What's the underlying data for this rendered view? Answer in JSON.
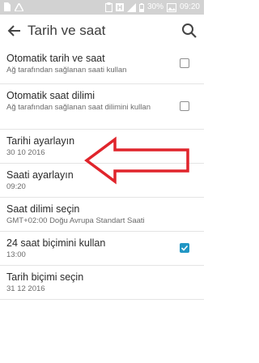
{
  "status_bar": {
    "battery_percent": "30%",
    "time": "09:20"
  },
  "app_bar": {
    "title": "Tarih ve saat"
  },
  "settings": [
    {
      "title": "Otomatik tarih ve saat",
      "subtitle": "Ağ tarafından sağlanan saati kullan",
      "checkbox": true,
      "checked": false
    },
    {
      "title": "Otomatik saat dilimi",
      "subtitle": "Ağ tarafından sağlanan saat dilimini kullan",
      "checkbox": true,
      "checked": false
    },
    {
      "title": "Tarihi ayarlayın",
      "subtitle": "30 10 2016",
      "checkbox": false
    },
    {
      "title": "Saati ayarlayın",
      "subtitle": "09:20",
      "checkbox": false
    },
    {
      "title": "Saat dilimi seçin",
      "subtitle": "GMT+02:00 Doğu Avrupa Standart Saati",
      "checkbox": false
    },
    {
      "title": "24 saat biçimini kullan",
      "subtitle": "13:00",
      "checkbox": true,
      "checked": true
    },
    {
      "title": "Tarih biçimi seçin",
      "subtitle": "31 12 2016",
      "checkbox": false
    }
  ],
  "colors": {
    "status_bar": "#d2d2d2",
    "checkbox_checked": "#2196c4",
    "annotation_arrow": "#e0242b"
  }
}
